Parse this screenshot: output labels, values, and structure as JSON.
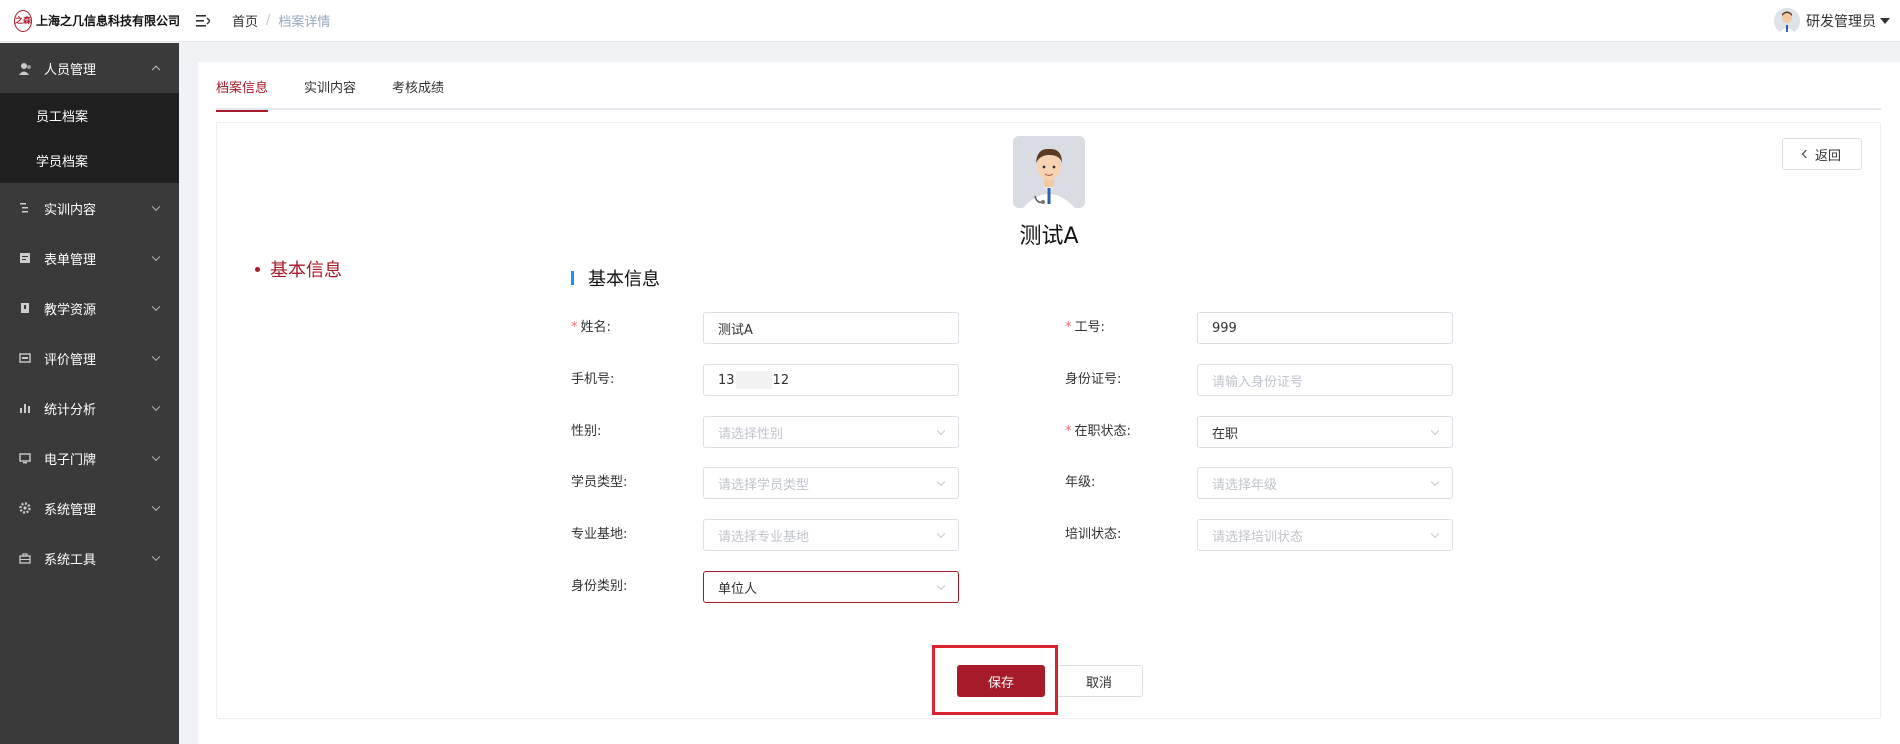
{
  "header": {
    "logo_mark": "之森",
    "company": "上海之几信息科技有限公司",
    "breadcrumb": {
      "home": "首页",
      "separator": "/",
      "current": "档案详情"
    },
    "user": {
      "name": "研发管理员"
    }
  },
  "sidebar": {
    "items": [
      {
        "label": "人员管理",
        "icon": "user-icon",
        "expanded": true,
        "children": [
          {
            "label": "员工档案"
          },
          {
            "label": "学员档案"
          }
        ]
      },
      {
        "label": "实训内容",
        "icon": "list-icon"
      },
      {
        "label": "表单管理",
        "icon": "form-icon"
      },
      {
        "label": "教学资源",
        "icon": "book-icon"
      },
      {
        "label": "评价管理",
        "icon": "rating-icon"
      },
      {
        "label": "统计分析",
        "icon": "chart-icon"
      },
      {
        "label": "电子门牌",
        "icon": "monitor-icon"
      },
      {
        "label": "系统管理",
        "icon": "gear-icon"
      },
      {
        "label": "系统工具",
        "icon": "toolbox-icon"
      }
    ]
  },
  "tabs": [
    {
      "label": "档案信息",
      "active": true
    },
    {
      "label": "实训内容",
      "active": false
    },
    {
      "label": "考核成绩",
      "active": false
    }
  ],
  "card": {
    "back_label": "返回",
    "person_name": "测试A",
    "anchor_label": "基本信息",
    "section_title": "基本信息"
  },
  "form": {
    "name": {
      "label": "姓名:",
      "value": "测试A",
      "required": true
    },
    "job_no": {
      "label": "工号:",
      "value": "999",
      "required": true
    },
    "phone": {
      "label": "手机号:",
      "value_prefix": "13",
      "value_suffix": "12"
    },
    "id_card": {
      "label": "身份证号:",
      "placeholder": "请输入身份证号"
    },
    "gender": {
      "label": "性别:",
      "placeholder": "请选择性别"
    },
    "job_status": {
      "label": "在职状态:",
      "value": "在职",
      "required": true
    },
    "student_type": {
      "label": "学员类型:",
      "placeholder": "请选择学员类型"
    },
    "grade": {
      "label": "年级:",
      "placeholder": "请选择年级"
    },
    "base": {
      "label": "专业基地:",
      "placeholder": "请选择专业基地"
    },
    "training_status": {
      "label": "培训状态:",
      "placeholder": "请选择培训状态"
    },
    "identity_type": {
      "label": "身份类别:",
      "value": "单位人"
    }
  },
  "actions": {
    "save_label": "保存",
    "cancel_label": "取消"
  },
  "colors": {
    "brand": "#a61b29",
    "highlight_frame": "#d9232f",
    "sidebar_bg": "#3a3a3a",
    "submenu_bg": "#1f1f1f"
  }
}
